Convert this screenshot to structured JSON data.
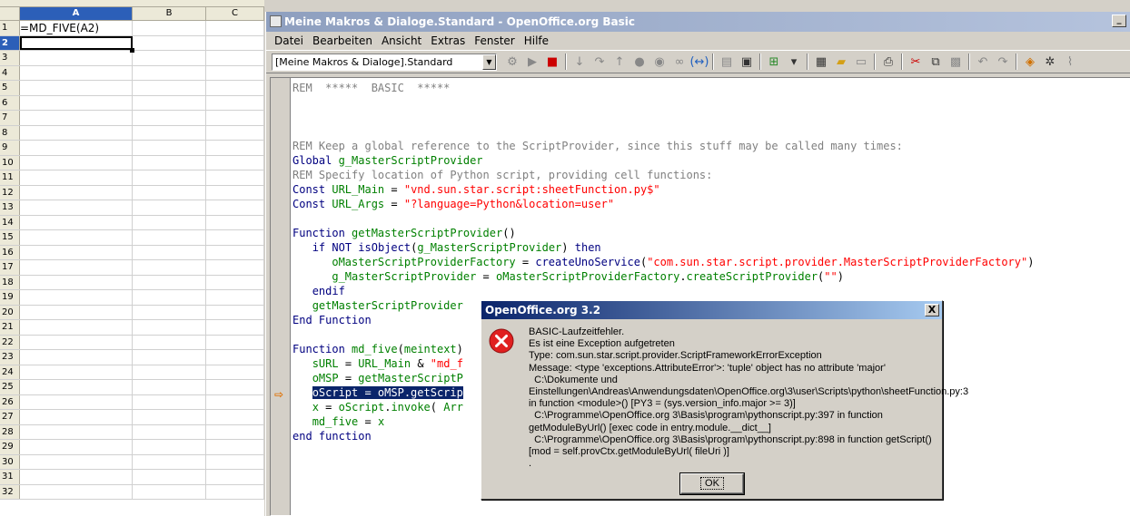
{
  "spreadsheet": {
    "columns": [
      "A",
      "B",
      "C"
    ],
    "selected_column": "A",
    "rows": [
      "1",
      "2",
      "3",
      "4",
      "5",
      "6",
      "7",
      "8",
      "9",
      "10",
      "11",
      "12",
      "13",
      "14",
      "15",
      "16",
      "17",
      "18",
      "19",
      "20",
      "21",
      "22",
      "23",
      "24",
      "25",
      "26",
      "27",
      "28",
      "29",
      "30",
      "31",
      "32"
    ],
    "selected_row": "2",
    "cell_A1": "=MD_FIVE(A2)"
  },
  "ide": {
    "title": "Meine Makros & Dialoge.Standard - OpenOffice.org Basic",
    "menu": [
      "Datei",
      "Bearbeiten",
      "Ansicht",
      "Extras",
      "Fenster",
      "Hilfe"
    ],
    "library_select": "[Meine Makros & Dialoge].Standard",
    "code_lines": [
      "REM  *****  BASIC  *****",
      "",
      "",
      "",
      "REM Keep a global reference to the ScriptProvider, since this stuff may be called many times:",
      "Global g_MasterScriptProvider",
      "REM Specify location of Python script, providing cell functions:",
      "Const URL_Main = \"vnd.sun.star.script:sheetFunction.py$\"",
      "Const URL_Args = \"?language=Python&location=user\"",
      "",
      "Function getMasterScriptProvider()",
      "   if NOT isObject(g_MasterScriptProvider) then",
      "      oMasterScriptProviderFactory = createUnoService(\"com.sun.star.script.provider.MasterScriptProviderFactory\")",
      "      g_MasterScriptProvider = oMasterScriptProviderFactory.createScriptProvider(\"\")",
      "   endif",
      "   getMasterScriptProvider",
      "End Function",
      "",
      "Function md_five(meintext)",
      "   sURL = URL_Main & \"md_f",
      "   oMSP = getMasterScriptP",
      "   oScript = oMSP.getScrip",
      "   x = oScript.invoke( Arr",
      "   md_five = x",
      "end function"
    ]
  },
  "dialog": {
    "title": "OpenOffice.org 3.2",
    "close_label": "X",
    "message": "BASIC-Laufzeitfehler.\nEs ist eine Exception aufgetreten\nType: com.sun.star.script.provider.ScriptFrameworkErrorException\nMessage: <type 'exceptions.AttributeError'>: 'tuple' object has no attribute 'major'\n  C:\\Dokumente und Einstellungen\\Andreas\\Anwendungsdaten\\OpenOffice.org\\3\\user\\Scripts\\python\\sheetFunction.py:3 in function <module>() [PY3 = (sys.version_info.major >= 3)]\n  C:\\Programme\\OpenOffice.org 3\\Basis\\program\\pythonscript.py:397 in function getModuleByUrl() [exec code in entry.module.__dict__]\n  C:\\Programme\\OpenOffice.org 3\\Basis\\program\\pythonscript.py:898 in function getScript() [mod = self.provCtx.getModuleByUrl( fileUri )]\n.",
    "ok_label": "OK",
    "icon": "error-icon"
  }
}
